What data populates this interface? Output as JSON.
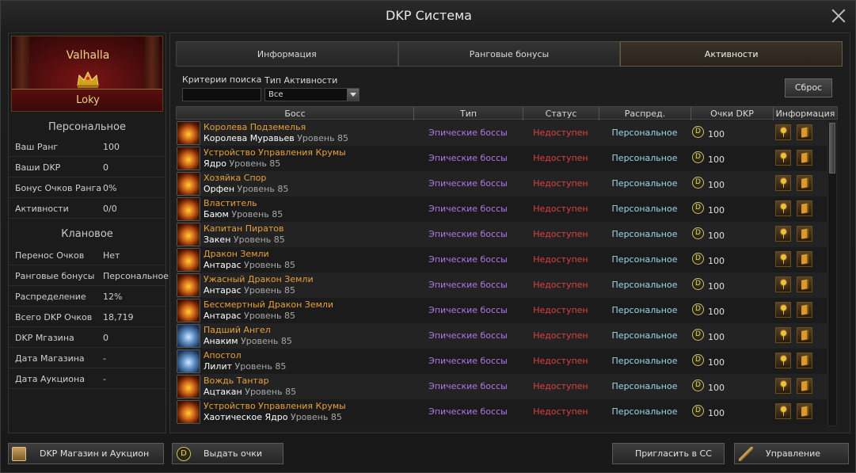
{
  "window": {
    "title": "DKP Система"
  },
  "clan": {
    "name": "Valhalla",
    "player": "Loky"
  },
  "personal": {
    "title": "Персональное",
    "rows": [
      {
        "label": "Ваш Ранг",
        "value": "100"
      },
      {
        "label": "Ваши DKP",
        "value": "0"
      },
      {
        "label": "Бонус Очков Ранга",
        "value": "0%"
      },
      {
        "label": "Активности",
        "value": "0/0"
      }
    ]
  },
  "clan_stats": {
    "title": "Клановое",
    "rows": [
      {
        "label": "Перенос Очков",
        "value": "Нет"
      },
      {
        "label": "Ранговые бонусы",
        "value": "Персональное"
      },
      {
        "label": "Распределение",
        "value": "12%"
      },
      {
        "label": "Всего DKP Очков",
        "value": "18,719"
      },
      {
        "label": "DKP Мгазина",
        "value": "0"
      },
      {
        "label": "Дата Магазина",
        "value": "-"
      },
      {
        "label": "Дата Аукциона",
        "value": "-"
      }
    ]
  },
  "tabs": [
    "Информация",
    "Ранговые бонусы",
    "Активности"
  ],
  "active_tab": "Активности",
  "filters": {
    "search_label": "Критерии поиска",
    "search_value": "",
    "type_label": "Тип Активности",
    "type_value": "Все",
    "reset_label": "Сброс"
  },
  "table": {
    "headers": [
      "Босс",
      "Тип",
      "Статус",
      "Распред.",
      "Очки DKP",
      "Информация"
    ],
    "rows": [
      {
        "name": "Королева Подземелья",
        "sub": "Королева Муравьев",
        "level": "Уровень 85",
        "type": "Эпические боссы",
        "status": "Недоступен",
        "dist": "Персональное",
        "points": "100",
        "icon": "fire"
      },
      {
        "name": "Устройство Управления Крумы",
        "sub": "Ядро",
        "level": "Уровень 85",
        "type": "Эпические боссы",
        "status": "Недоступен",
        "dist": "Персональное",
        "points": "100",
        "icon": "fire"
      },
      {
        "name": "Хозяйка Спор",
        "sub": "Орфен",
        "level": "Уровень 85",
        "type": "Эпические боссы",
        "status": "Недоступен",
        "dist": "Персональное",
        "points": "100",
        "icon": "fire"
      },
      {
        "name": "Властитель",
        "sub": "Баюм",
        "level": "Уровень 85",
        "type": "Эпические боссы",
        "status": "Недоступен",
        "dist": "Персональное",
        "points": "100",
        "icon": "fire"
      },
      {
        "name": "Капитан Пиратов",
        "sub": "Закен",
        "level": "Уровень 85",
        "type": "Эпические боссы",
        "status": "Недоступен",
        "dist": "Персональное",
        "points": "100",
        "icon": "fire"
      },
      {
        "name": "Дракон Земли",
        "sub": "Антарас",
        "level": "Уровень 85",
        "type": "Эпические боссы",
        "status": "Недоступен",
        "dist": "Персональное",
        "points": "100",
        "icon": "fire"
      },
      {
        "name": "Ужасный Дракон Земли",
        "sub": "Антарас",
        "level": "Уровень 85",
        "type": "Эпические боссы",
        "status": "Недоступен",
        "dist": "Персональное",
        "points": "100",
        "icon": "fire"
      },
      {
        "name": "Бессмертный Дракон Земли",
        "sub": "Антарас",
        "level": "Уровень 85",
        "type": "Эпические боссы",
        "status": "Недоступен",
        "dist": "Персональное",
        "points": "100",
        "icon": "fire"
      },
      {
        "name": "Падший Ангел",
        "sub": "Анаким",
        "level": "Уровень 85",
        "type": "Эпические боссы",
        "status": "Недоступен",
        "dist": "Персональное",
        "points": "100",
        "icon": "ice"
      },
      {
        "name": "Апостол",
        "sub": "Лилит",
        "level": "Уровень 85",
        "type": "Эпические боссы",
        "status": "Недоступен",
        "dist": "Персональное",
        "points": "100",
        "icon": "ice"
      },
      {
        "name": "Вождь Тантар",
        "sub": "Ацтакан",
        "level": "Уровень 85",
        "type": "Эпические боссы",
        "status": "Недоступен",
        "dist": "Персональное",
        "points": "100",
        "icon": "fire"
      },
      {
        "name": "Устройство Управления Крумы",
        "sub": "Хаотическое Ядро",
        "level": "Уровень 85",
        "type": "Эпические боссы",
        "status": "Недоступен",
        "dist": "Персональное",
        "points": "100",
        "icon": "fire"
      }
    ]
  },
  "buttons": {
    "shop": "DKP Магазин и Аукцион",
    "withdraw": "Выдать очки",
    "invite": "Пригласить в СС",
    "manage": "Управление"
  },
  "coin_symbol": "D",
  "colors": {
    "boss_name": "#e8a040",
    "type": "#b276e8",
    "status": "#e04040",
    "dist": "#9ad8e6",
    "clan_text": "#e8d489"
  }
}
